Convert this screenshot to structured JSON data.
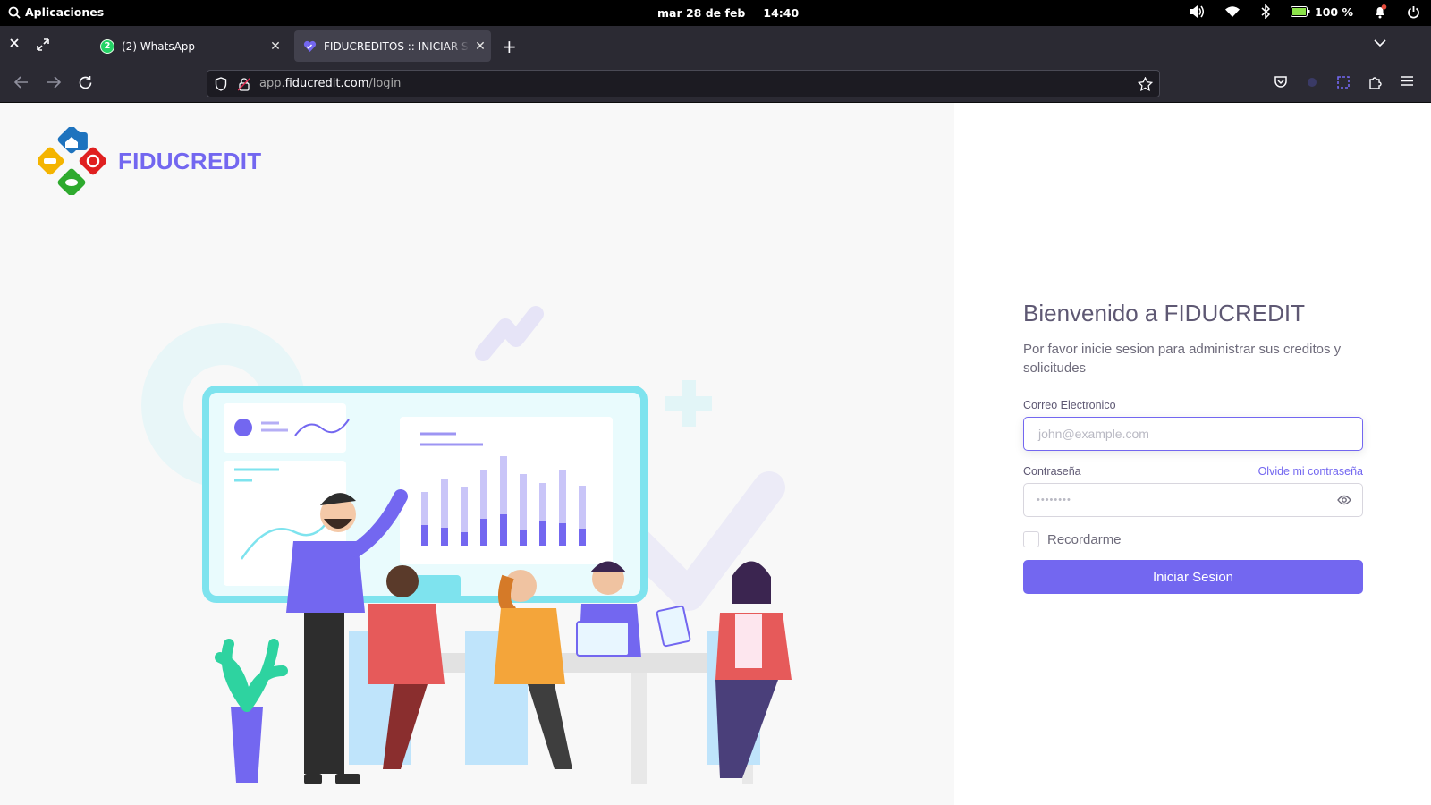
{
  "system_bar": {
    "apps_label": "Aplicaciones",
    "date": "mar 28 de feb",
    "time": "14:40",
    "battery": "100 %"
  },
  "browser": {
    "tabs": [
      {
        "title": "(2) WhatsApp",
        "badge": "2",
        "icon": "whatsapp-icon"
      },
      {
        "title": "FIDUCREDITOS :: INICIAR SESION",
        "icon": "fiducredit-heart-icon"
      }
    ],
    "url": {
      "prefix": "app.",
      "domain": "fiducredit.com",
      "path": "/login"
    }
  },
  "brand": {
    "name": "FIDUCREDIT"
  },
  "login": {
    "welcome": "Bienvenido a FIDUCREDIT",
    "subtitle": "Por favor inicie sesion para administrar sus creditos y solicitudes",
    "email_label": "Correo Electronico",
    "email_placeholder": "john@example.com",
    "password_label": "Contraseña",
    "forgot_label": "Olvide mi contraseña",
    "password_placeholder": "••••••••",
    "remember_label": "Recordarme",
    "submit_label": "Iniciar Sesion"
  },
  "colors": {
    "primary": "#7367f0",
    "browser_chrome": "#2b2a33",
    "top_bar": "#000000"
  }
}
